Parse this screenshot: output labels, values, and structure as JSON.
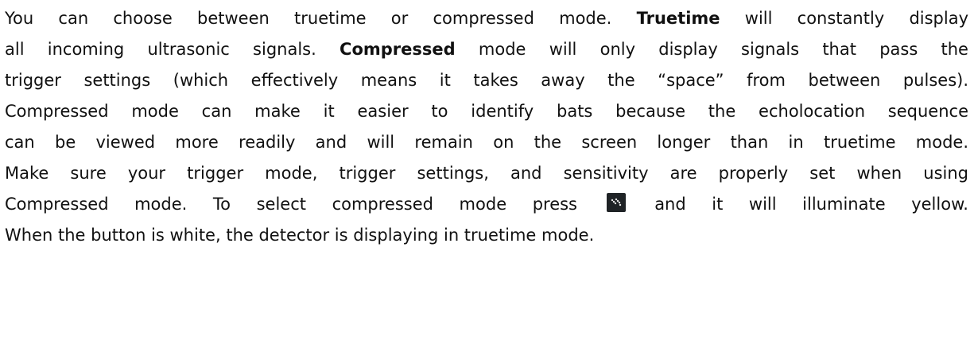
{
  "paragraph": {
    "line1": {
      "pre": "You can choose between truetime or compressed mode.",
      "bold": "Truetime",
      "post": "will constantly display"
    },
    "line2": {
      "pre": "all incoming ultrasonic signals.",
      "bold": "Compressed",
      "post": "mode will only display signals that pass the"
    },
    "line3": "trigger settings (which effectively means it takes away the “space” from between pulses).",
    "line4": "Compressed mode can make it easier to identify bats because the echolocation sequence",
    "line5": "can be viewed more readily and will remain on the screen longer than in truetime mode.",
    "line6": "Make sure your trigger mode, trigger settings, and sensitivity are properly set when using",
    "line7": {
      "pre": "Compressed mode. To select compressed mode press",
      "icon": "compressed-mode-icon",
      "post": "and it will illuminate yellow."
    },
    "line8": "When the button is white, the detector is displaying in truetime mode."
  }
}
